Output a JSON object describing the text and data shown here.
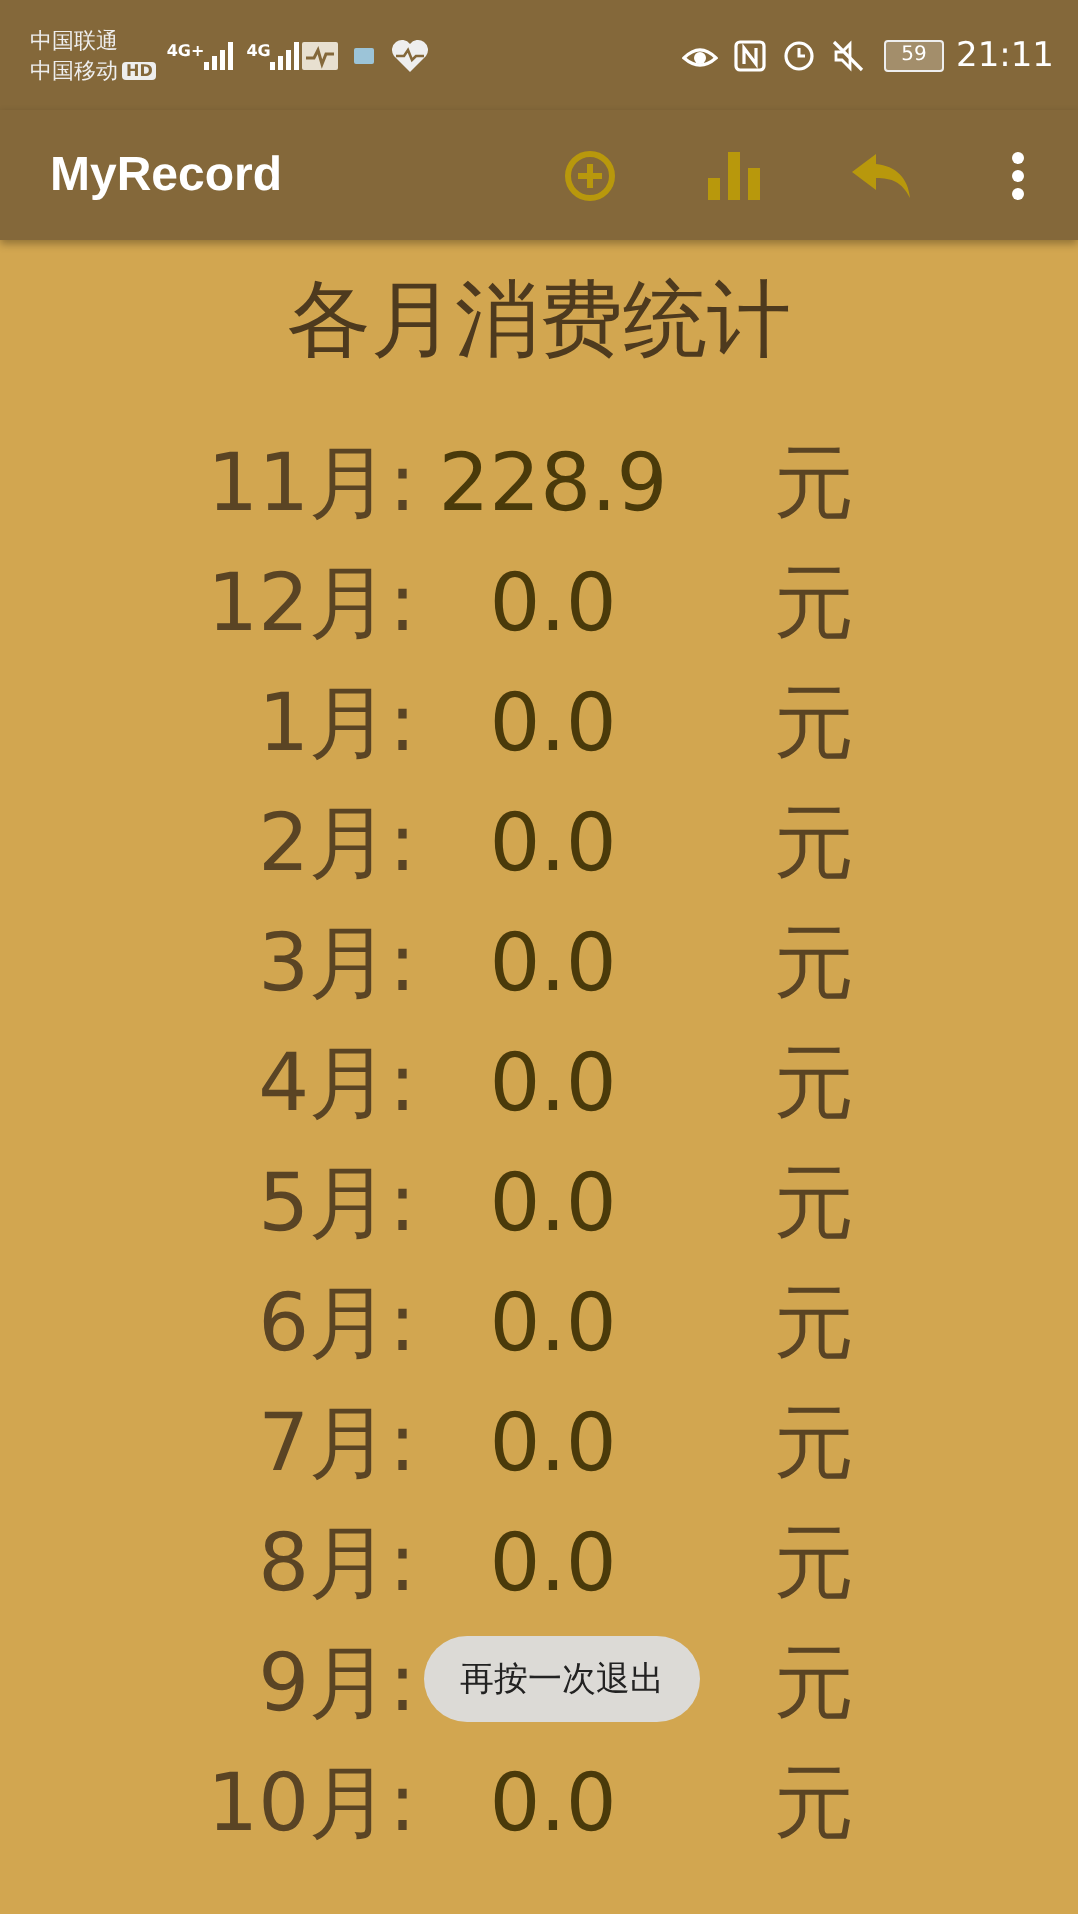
{
  "status_bar": {
    "carriers": [
      "中国联通",
      "中国移动"
    ],
    "hd_badge": "HD",
    "networks": [
      "4G+",
      "4G"
    ],
    "battery": "59",
    "time": "21:11"
  },
  "app_bar": {
    "title": "MyRecord"
  },
  "heading": "各月消费统计",
  "rows": [
    {
      "month": "11月:",
      "amount": "228.9",
      "unit": "元"
    },
    {
      "month": "12月:",
      "amount": "0.0",
      "unit": "元"
    },
    {
      "month": "1月:",
      "amount": "0.0",
      "unit": "元"
    },
    {
      "month": "2月:",
      "amount": "0.0",
      "unit": "元"
    },
    {
      "month": "3月:",
      "amount": "0.0",
      "unit": "元"
    },
    {
      "month": "4月:",
      "amount": "0.0",
      "unit": "元"
    },
    {
      "month": "5月:",
      "amount": "0.0",
      "unit": "元"
    },
    {
      "month": "6月:",
      "amount": "0.0",
      "unit": "元"
    },
    {
      "month": "7月:",
      "amount": "0.0",
      "unit": "元"
    },
    {
      "month": "8月:",
      "amount": "0.0",
      "unit": "元"
    },
    {
      "month": "9月:",
      "unit": "元"
    },
    {
      "month": "10月:",
      "amount": "0.0",
      "unit": "元"
    }
  ],
  "toast": "再按一次退出"
}
